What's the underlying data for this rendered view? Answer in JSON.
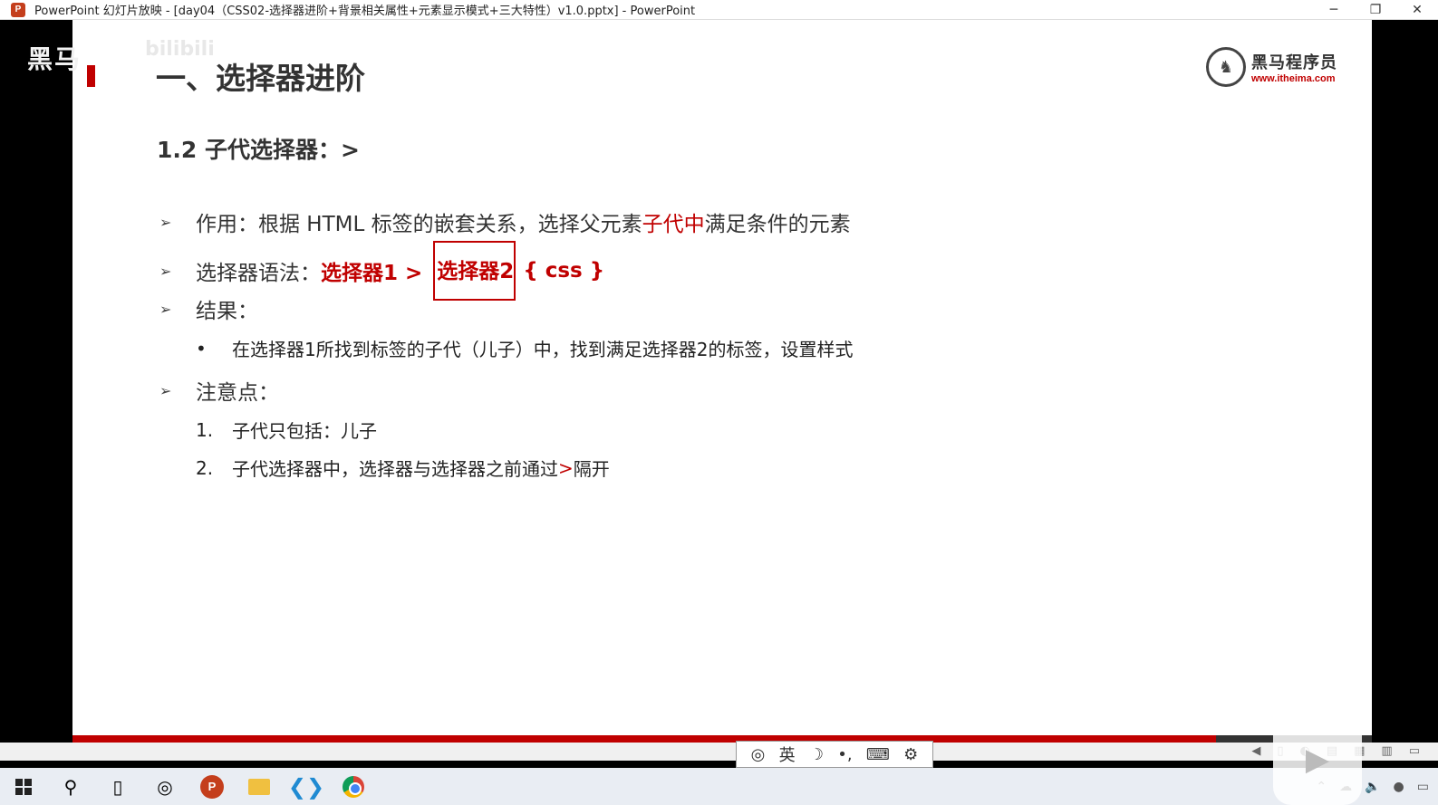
{
  "window": {
    "title": "PowerPoint 幻灯片放映 - [day04（CSS02-选择器进阶+背景相关属性+元素显示模式+三大特性）v1.0.pptx] - PowerPoint",
    "app_icon_letter": "P",
    "minimize": "─",
    "restore": "❐",
    "close": "✕"
  },
  "slide": {
    "watermark": "黑马",
    "watermark_extra": "bilibili",
    "title": "一、选择器进阶",
    "logo_name": "黑马程序员",
    "logo_url": "www.itheima.com",
    "subtitle": "1.2 子代选择器：>",
    "row1": {
      "label": "作用：根据 HTML 标签的嵌套关系，选择父元素 ",
      "highlight": "子代中",
      "tail": " 满足条件的元素"
    },
    "row2": {
      "label": "选择器语法：",
      "sel1": "选择器1 >",
      "sel2": "选择器2",
      "css": "{ css }"
    },
    "row3": {
      "label": "结果：",
      "bullet": "•",
      "detail": "在选择器1所找到标签的子代（儿子）中，找到满足选择器2的标签，设置样式"
    },
    "row4": {
      "label": "注意点：",
      "items": [
        {
          "num": "1.",
          "text": "子代只包括：儿子"
        },
        {
          "num": "2.",
          "text": "子代选择器中，选择器与选择器之前通过 ",
          "red": ">",
          "tail": " 隔开"
        }
      ]
    },
    "progress": 0.9
  },
  "ime": {
    "lang": "英",
    "moon": "☽",
    "punct": "•,",
    "keyboard": "⌨",
    "settings": "⚙"
  },
  "colors": {
    "accent_red": "#c00000",
    "ppt_orange": "#c43e1c"
  }
}
